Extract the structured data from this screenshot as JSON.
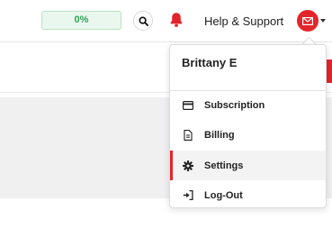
{
  "header": {
    "progress_text": "0%",
    "progress_value": 0,
    "help_label": "Help & Support",
    "icons": {
      "search": "search-icon",
      "notifications": "bell-icon",
      "avatar": "mail-icon",
      "menu_toggle": "caret-down-icon"
    }
  },
  "user_menu": {
    "user_name": "Brittany E",
    "items": [
      {
        "label": "Subscription",
        "icon": "card-icon",
        "active": false
      },
      {
        "label": "Billing",
        "icon": "document-icon",
        "active": false
      },
      {
        "label": "Settings",
        "icon": "gear-icon",
        "active": true
      },
      {
        "label": "Log-Out",
        "icon": "logout-icon",
        "active": false
      }
    ]
  },
  "colors": {
    "accent": "#e4242b",
    "progress_green": "#2ea355",
    "progress_bg": "#eaf7ee"
  }
}
